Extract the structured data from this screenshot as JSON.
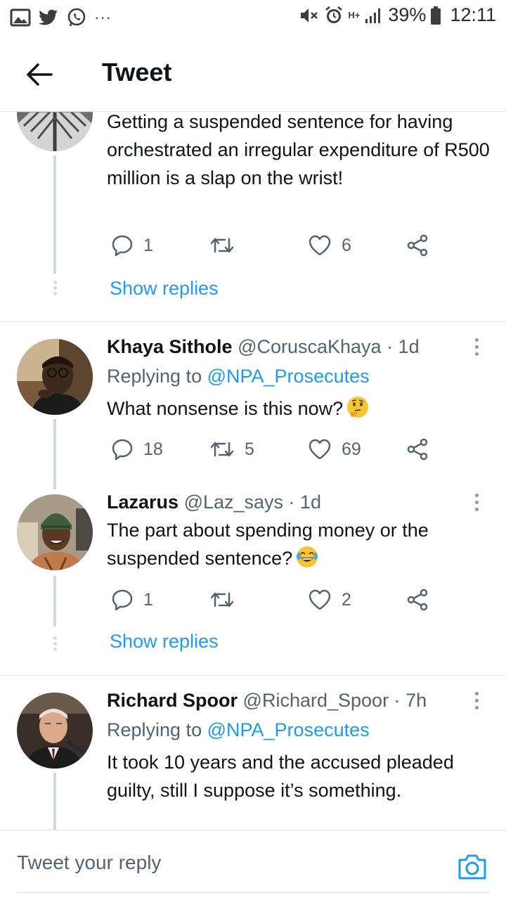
{
  "status_bar": {
    "battery": "39%",
    "time": "12:11",
    "more": "···",
    "network": "H+"
  },
  "header": {
    "title": "Tweet"
  },
  "tweets": [
    {
      "text": "Getting a suspended sentence for having orchestrated an irregular expenditure of R500 million is a slap on the wrist!",
      "replies": "1",
      "retweets": "",
      "likes": "6",
      "show_replies": "Show replies"
    },
    {
      "name": "Khaya Sithole",
      "handle": "@CoruscaKhaya · 1d",
      "replying_label": "Replying to",
      "replying_to": "@NPA_Prosecutes",
      "text": "What nonsense is this now?",
      "emoji": "thinking-face",
      "replies": "18",
      "retweets": "5",
      "likes": "69"
    },
    {
      "name": "Lazarus",
      "handle": "@Laz_says · 1d",
      "text": "The part about spending money or the suspended sentence?",
      "emoji": "laughing-tears-face",
      "replies": "1",
      "retweets": "",
      "likes": "2",
      "show_replies": "Show replies"
    },
    {
      "name": "Richard Spoor",
      "handle": "@Richard_Spoor · 7h",
      "replying_label": "Replying to",
      "replying_to": "@NPA_Prosecutes",
      "text": "It took 10 years and the accused pleaded guilty, still I suppose it’s something."
    }
  ],
  "compose": {
    "placeholder": "Tweet your reply"
  },
  "colors": {
    "accent": "#1d9bf0",
    "text": "#0f1419",
    "secondary": "#536471",
    "thread_line": "#cfd9de"
  }
}
